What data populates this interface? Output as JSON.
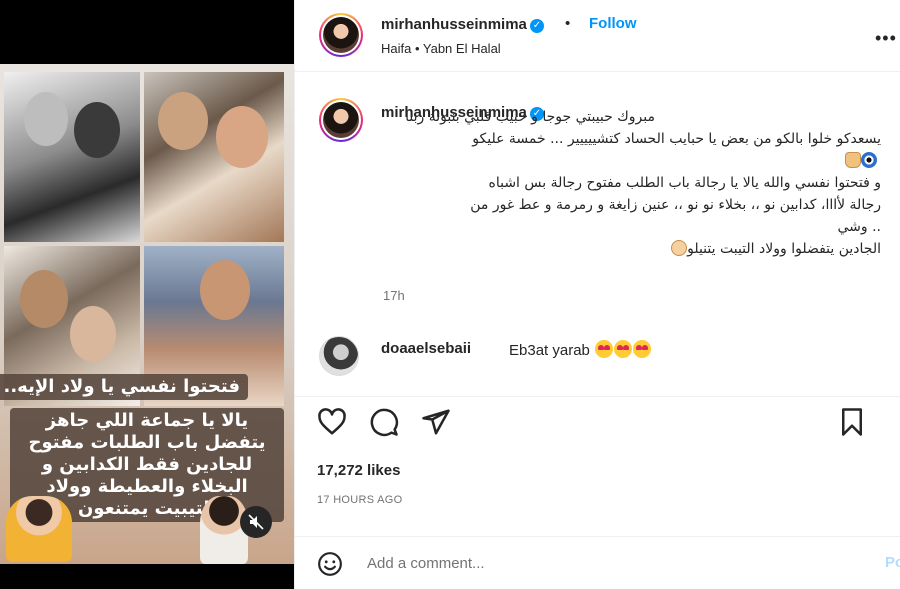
{
  "post": {
    "author": "mirhanhusseinmima",
    "follow_label": "Follow",
    "dot": "•",
    "location": "Haifa • Yabn El Halal",
    "more_label": "•••"
  },
  "caption": {
    "author": "mirhanhusseinmima",
    "line1": "مبروك حبيبتي جوجا و حبيب قلبي بنبونة ربنا",
    "line2": "يسعدكو خلوا بالكو من بعض يا حبايب الحساد كتشييييير ... خمسة عليكو",
    "line3": "و فتحتوا نفسي والله يالا يا رجالة باب الطلب مفتوح رجالة بس اشباه",
    "line4": "رجالة لأااا، كدابين نو ،، بخلاء نو نو ،، عنين زايغة و رمرمة و عط غور من",
    "line5": ".. وشي",
    "line6": "الجادين يتفضلوا وولاد التيبت يتنيلو",
    "time": "17h"
  },
  "comment": {
    "author": "doaaelsebaii",
    "text": "Eb3at yarab"
  },
  "story_overlay": {
    "line1": "فتحتوا نفسي يا ولاد الإيه..",
    "line2": "يالا يا جماعة اللي جاهز يتفضل باب الطلبات مفتوح للجادين فقط الكدابين و البخلاء والعطيطة وولاد التيبيت يمتنعون"
  },
  "stats": {
    "likes": "17,272 likes",
    "time_ago": "17 HOURS AGO"
  },
  "add_comment": {
    "placeholder": "Add a comment...",
    "post_label": "Post"
  },
  "colors": {
    "accent": "#0095f6",
    "text": "#262626",
    "muted": "#737373"
  },
  "icons": [
    "verified-badge-icon",
    "more-options-icon",
    "evil-eye-icon",
    "raised-hand-icon",
    "fist-icon",
    "heart-eyes-icon",
    "heart-icon",
    "comment-icon",
    "share-icon",
    "bookmark-icon",
    "emoji-icon",
    "mute-icon"
  ]
}
